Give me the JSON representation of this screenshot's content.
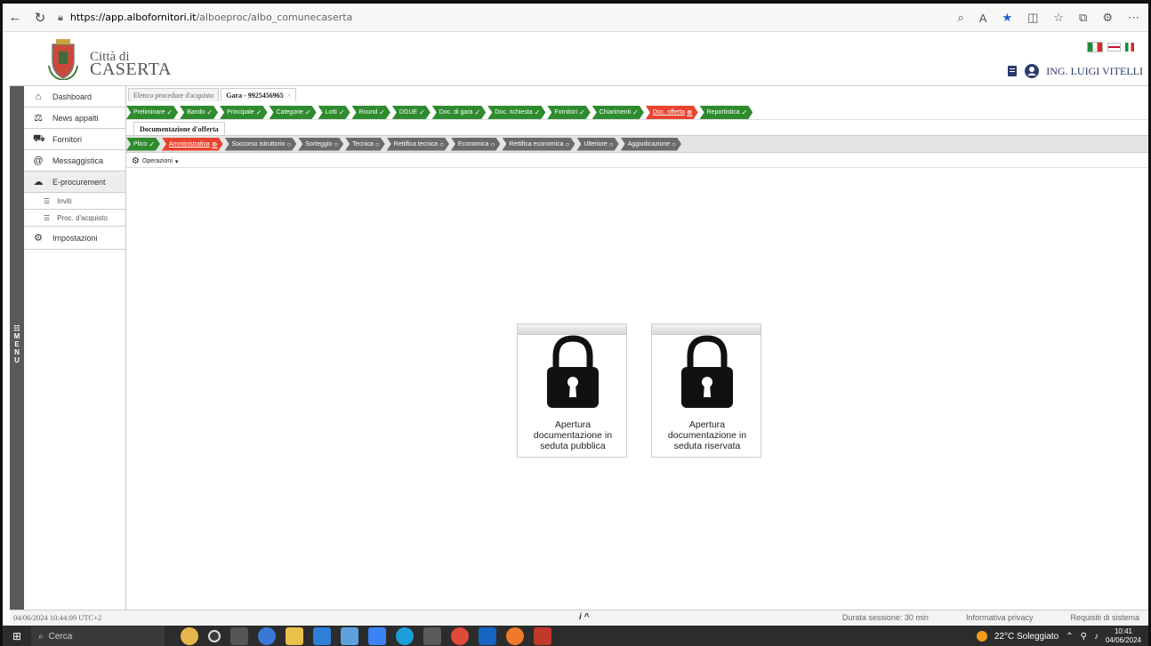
{
  "browser": {
    "url_host": "https://app.albofornitori.it",
    "url_path": "/alboeproc/albo_comunecaserta",
    "icons": [
      "back-icon",
      "refresh-icon",
      "lock-icon",
      "zoom-icon",
      "read-aloud-icon",
      "favorite-star-icon",
      "split-icon",
      "favorites-icon",
      "collections-icon",
      "extension-icon",
      "more-icon"
    ]
  },
  "header": {
    "city_small": "Città di",
    "city_big": "CASERTA",
    "user_name": "ING. LUIGI VITELLI"
  },
  "menu_label": "MENU",
  "sidebar": {
    "items": [
      {
        "label": "Dashboard",
        "icon": "home-icon"
      },
      {
        "label": "News appalti",
        "icon": "scale-icon"
      },
      {
        "label": "Fornitori",
        "icon": "truck-icon"
      },
      {
        "label": "Messaggistica",
        "icon": "at-icon"
      },
      {
        "label": "E-procurement",
        "icon": "cloud-icon"
      }
    ],
    "sub_items": [
      {
        "label": "Inviti"
      },
      {
        "label": "Proc. d'acquisto"
      }
    ],
    "settings": {
      "label": "Impostazioni"
    }
  },
  "doc_tabs": [
    {
      "label": "Elenco procedure d'acquisto"
    },
    {
      "label": "Gara - 9925456965",
      "close": "×"
    }
  ],
  "steps_top": [
    {
      "label": "Preliminare",
      "state": "green",
      "mark": "✓"
    },
    {
      "label": "Bando",
      "state": "green",
      "mark": "✓"
    },
    {
      "label": "Principale",
      "state": "green",
      "mark": "✓"
    },
    {
      "label": "Categorie",
      "state": "green",
      "mark": "✓"
    },
    {
      "label": "Lotti",
      "state": "green",
      "mark": "✓"
    },
    {
      "label": "Round",
      "state": "green",
      "mark": "✓"
    },
    {
      "label": "DGUE",
      "state": "green",
      "mark": "✓"
    },
    {
      "label": "Doc. di gara",
      "state": "green",
      "mark": "✓"
    },
    {
      "label": "Doc. richiesta",
      "state": "green",
      "mark": "✓"
    },
    {
      "label": "Fornitori",
      "state": "green",
      "mark": "✓"
    },
    {
      "label": "Chiarimenti",
      "state": "green",
      "mark": "✓"
    },
    {
      "label": "Doc. offerta",
      "state": "red",
      "mark": "⊗"
    },
    {
      "label": "Reportistica",
      "state": "green",
      "mark": "✓"
    }
  ],
  "sub_tab": "Documentazione d'offerta",
  "steps_bottom": [
    {
      "label": "Plico",
      "state": "green",
      "mark": "✓"
    },
    {
      "label": "Amministrativa",
      "state": "red",
      "mark": "⊗"
    },
    {
      "label": "Soccorso istruttorio",
      "state": "grey",
      "mark": "○"
    },
    {
      "label": "Sorteggio",
      "state": "grey",
      "mark": "○"
    },
    {
      "label": "Tecnica",
      "state": "grey",
      "mark": "○"
    },
    {
      "label": "Rettifica tecnica",
      "state": "grey",
      "mark": "○"
    },
    {
      "label": "Economica",
      "state": "grey",
      "mark": "○"
    },
    {
      "label": "Rettifica economica",
      "state": "grey",
      "mark": "○"
    },
    {
      "label": "Ulteriore",
      "state": "grey",
      "mark": "○"
    },
    {
      "label": "Aggiudicazione",
      "state": "grey",
      "mark": "○"
    }
  ],
  "operations": {
    "label": "Operazioni",
    "caret": "▾"
  },
  "cards": [
    {
      "line1": "Apertura",
      "line2": "documentazione in",
      "line3": "seduta pubblica"
    },
    {
      "line1": "Apertura",
      "line2": "documentazione in",
      "line3": "seduta riservata"
    }
  ],
  "status": {
    "datetime": "04/06/2024 10:44:09 UTC+2",
    "info": "i ^",
    "session": "Durata sessione: 30 min",
    "privacy": "Informativa privacy",
    "requirements": "Requisiti di sistema"
  },
  "taskbar": {
    "search": "Cerca",
    "weather": "22°C Soleggiato",
    "time": "10:41",
    "date": "04/06/2024"
  },
  "colors": {
    "step_green": "#2e8b2e",
    "step_red": "#e8432e",
    "step_grey": "#6a6a6a"
  }
}
